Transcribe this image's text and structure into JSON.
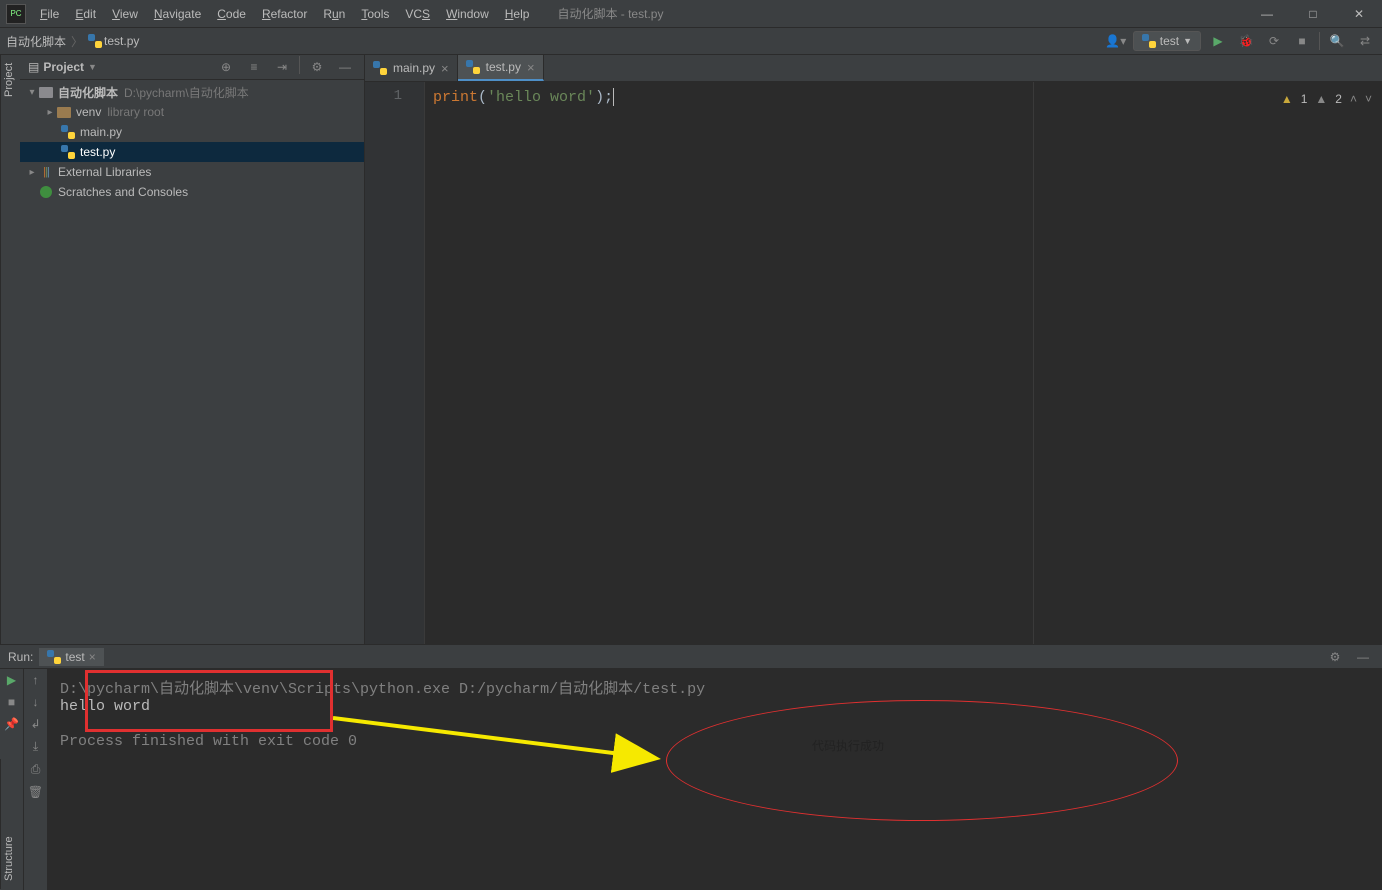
{
  "window_title": "自动化脚本 - test.py",
  "menu": [
    "File",
    "Edit",
    "View",
    "Navigate",
    "Code",
    "Refactor",
    "Run",
    "Tools",
    "VCS",
    "Window",
    "Help"
  ],
  "breadcrumb": {
    "root": "自动化脚本",
    "file": "test.py"
  },
  "run_config": {
    "name": "test"
  },
  "project_panel": {
    "title": "Project",
    "root": {
      "name": "自动化脚本",
      "path": "D:\\pycharm\\自动化脚本"
    },
    "venv": {
      "name": "venv",
      "hint": "library root"
    },
    "files": {
      "main": "main.py",
      "test": "test.py"
    },
    "external": "External Libraries",
    "scratches": "Scratches and Consoles"
  },
  "editor": {
    "tabs": {
      "main": "main.py",
      "test": "test.py"
    },
    "line_no": "1",
    "code": {
      "fn": "print",
      "open": "(",
      "str": "'hello word'",
      "close": ");"
    },
    "warnings": {
      "w1": "1",
      "w2": "2"
    }
  },
  "run": {
    "label": "Run:",
    "tab": "test",
    "cmd": "D:\\pycharm\\自动化脚本\\venv\\Scripts\\python.exe D:/pycharm/自动化脚本/test.py",
    "output": "hello word",
    "finished": "Process finished with exit code 0"
  },
  "side_tabs": {
    "project": "Project",
    "structure": "Structure"
  },
  "annotation": {
    "text": "代码执行成功"
  }
}
